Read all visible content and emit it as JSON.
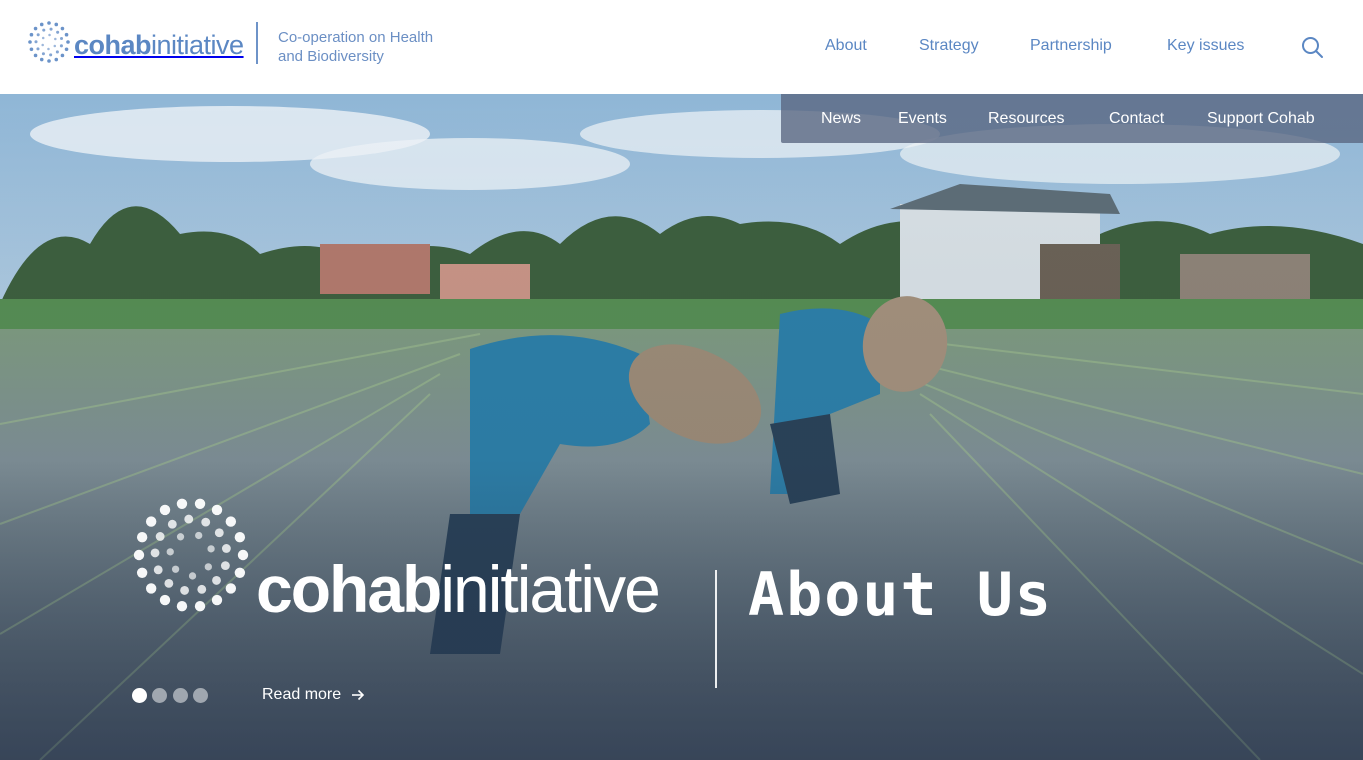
{
  "brand": {
    "logo_bold": "cohab",
    "logo_light": "initiative",
    "tagline_line1": "Co-operation on Health",
    "tagline_line2": "and Biodiversity"
  },
  "main_nav": {
    "items": [
      {
        "label": "About"
      },
      {
        "label": "Strategy"
      },
      {
        "label": "Partnership"
      },
      {
        "label": "Key issues"
      }
    ],
    "search_icon": "search-icon"
  },
  "sub_nav": {
    "items": [
      {
        "label": "News"
      },
      {
        "label": "Events"
      },
      {
        "label": "Resources"
      },
      {
        "label": "Contact"
      },
      {
        "label": "Support Cohab"
      }
    ]
  },
  "hero": {
    "logo_bold": "cohab",
    "logo_light": "initiative",
    "title": "About Us",
    "read_more": "Read more",
    "slides_total": 4,
    "active_slide": 1
  },
  "colors": {
    "brand_blue": "#5b87c3",
    "subnav_bg": "#586580",
    "white": "#ffffff"
  }
}
